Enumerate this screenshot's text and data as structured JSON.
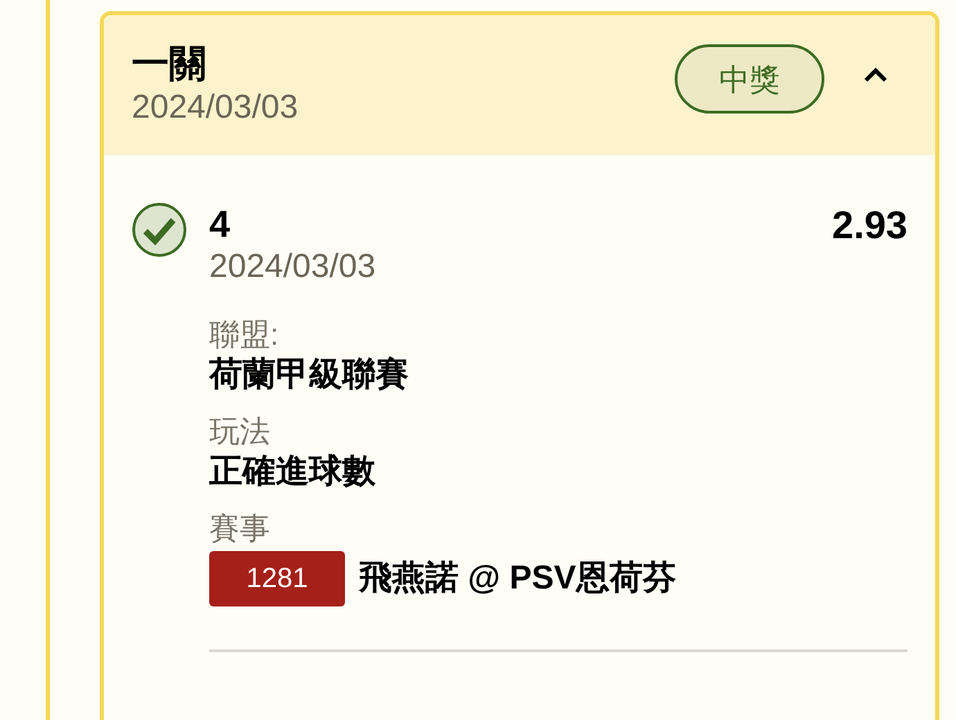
{
  "card": {
    "title": "一關",
    "date": "2024/03/03",
    "status": {
      "label": "中獎",
      "kind": "won"
    },
    "expanded": true
  },
  "selection": {
    "checked": true,
    "pick": "4",
    "date": "2024/03/03",
    "odds": "2.93",
    "fields": [
      {
        "label": "聯盟:",
        "value": "荷蘭甲級聯賽"
      },
      {
        "label": "玩法",
        "value": "正確進球數"
      }
    ],
    "event": {
      "label": "賽事",
      "code": "1281",
      "name": "飛燕諾 @ PSV恩荷芬"
    }
  }
}
